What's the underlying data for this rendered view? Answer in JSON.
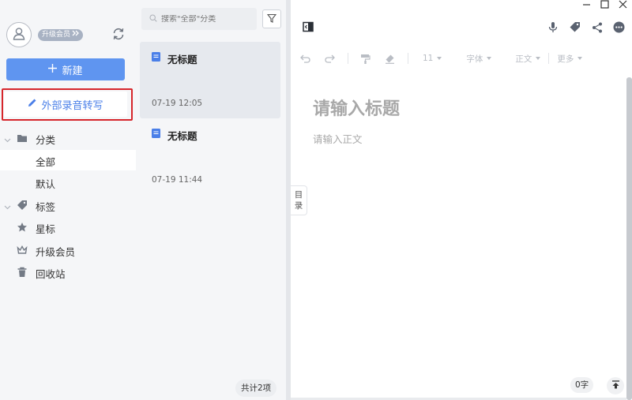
{
  "sidebar": {
    "vip_badge": "升级会员",
    "new_button": "新建",
    "transcribe_button": "外部录音转写",
    "categories_label": "分类",
    "all_label": "全部",
    "default_label": "默认",
    "tags_label": "标签",
    "starred_label": "星标",
    "upgrade_label": "升级会员",
    "trash_label": "回收站"
  },
  "list": {
    "search_placeholder": "搜索\"全部\"分类",
    "notes": [
      {
        "title": "无标题",
        "date": "07-19 12:05"
      },
      {
        "title": "无标题",
        "date": "07-19 11:44"
      }
    ],
    "count": "共计2项"
  },
  "editor": {
    "font_size": "11",
    "font_family": "字体",
    "paragraph_style": "正文",
    "more_label": "更多",
    "title_placeholder": "请输入标题",
    "body_placeholder": "请输入正文",
    "toc_label_1": "目",
    "toc_label_2": "录",
    "word_count": "0字"
  },
  "colors": {
    "accent": "#5f95f0",
    "highlight_border": "#d6262b",
    "sidebar_bg": "#f5f6f8"
  }
}
